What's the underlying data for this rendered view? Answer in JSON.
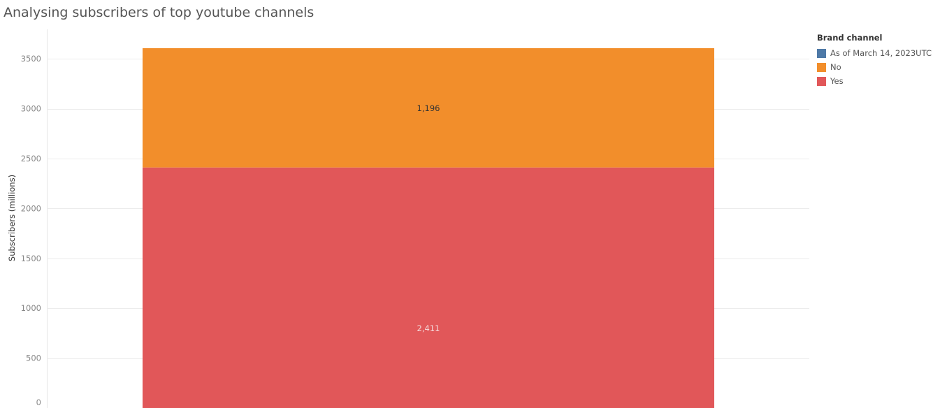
{
  "title": "Analysing subscribers of top youtube channels",
  "chart_data": {
    "type": "bar",
    "stacked": true,
    "ylabel": "Subscribers (millions)",
    "ylim": [
      0,
      3600
    ],
    "yticks": [
      0,
      500,
      1000,
      1500,
      2000,
      2500,
      3000,
      3500
    ],
    "grid": true,
    "series": [
      {
        "name": "Yes",
        "value": 2411,
        "label": "2,411",
        "color": "#e15759",
        "label_color": "#f5d9da"
      },
      {
        "name": "No",
        "value": 1196,
        "label": "1,196",
        "color": "#f28e2b",
        "label_color": "#333333"
      }
    ]
  },
  "legend": {
    "title": "Brand channel",
    "placement": "top-right",
    "items": [
      {
        "label": "As of March 14, 2023UTC",
        "color": "#4e79a7"
      },
      {
        "label": "No",
        "color": "#f28e2b"
      },
      {
        "label": "Yes",
        "color": "#e15759"
      }
    ]
  }
}
